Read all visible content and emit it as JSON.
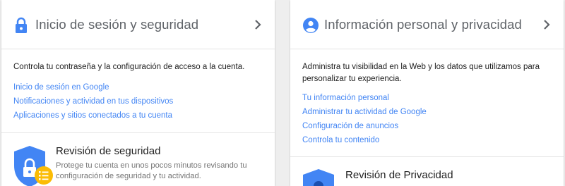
{
  "cards": [
    {
      "title": "Inicio de sesión y seguridad",
      "header_icon": "lock-icon",
      "description": "Controla tu contraseña y la configuración de acceso a la cuenta.",
      "links": [
        "Inicio de sesión en Google",
        "Notificaciones y actividad en tus dispositivos",
        "Aplicaciones y sitios conectados a tu cuenta"
      ],
      "feature": {
        "icon": "security-shield-icon",
        "title": "Revisión de seguridad",
        "text": "Protege tu cuenta en unos pocos minutos revisando tu configuración de seguridad y tu actividad."
      }
    },
    {
      "title": "Información personal y privacidad",
      "header_icon": "person-icon",
      "description": "Administra tu visibilidad en la Web y los datos que utilizamos para personalizar tu experiencia.",
      "links": [
        "Tu información personal",
        "Administrar tu actividad de Google",
        "Configuración de anuncios",
        "Controla tu contenido"
      ],
      "feature": {
        "icon": "privacy-shield-icon",
        "title": "Revisión de Privacidad"
      }
    }
  ],
  "colors": {
    "link": "#4285f4",
    "icon_blue": "#4285f4",
    "badge_yellow": "#fbbc05",
    "title_gray": "#5f6368",
    "chevron": "#5f6368",
    "divider": "#e4e4e4"
  }
}
